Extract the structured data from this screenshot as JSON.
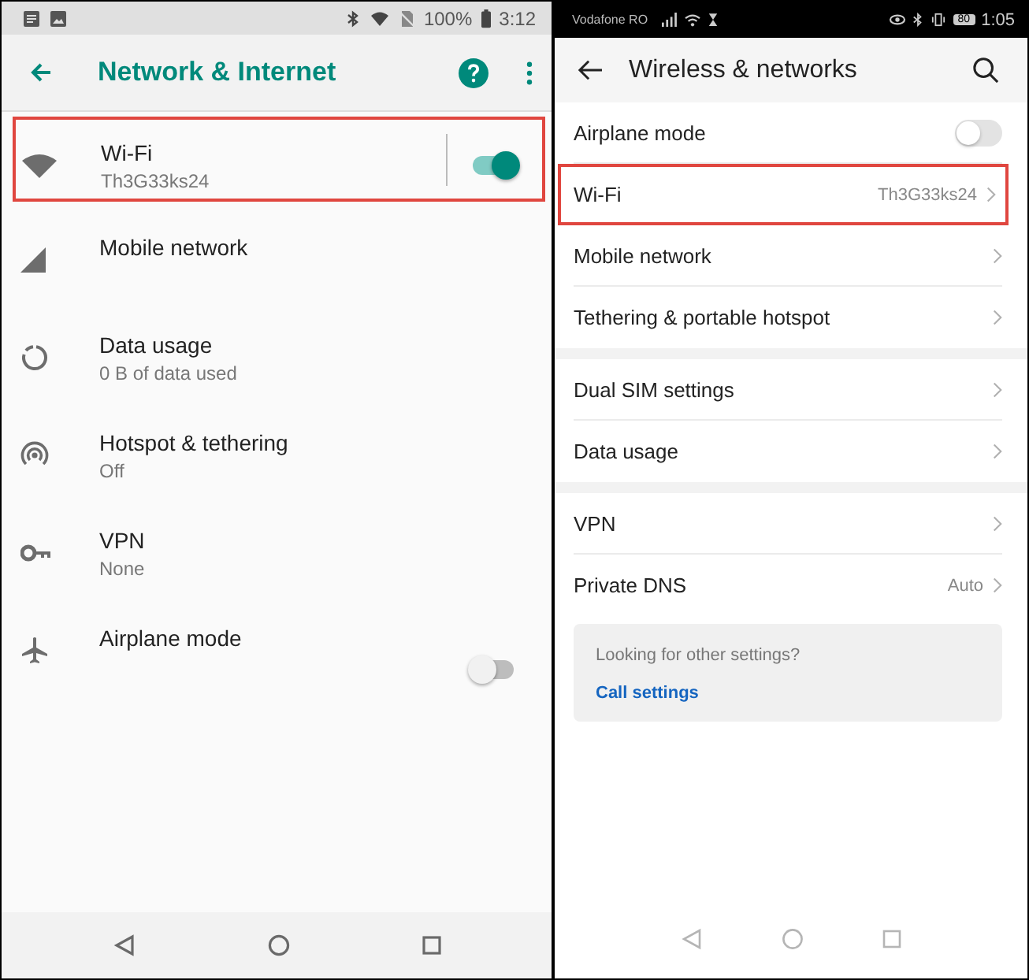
{
  "left_phone": {
    "status_bar": {
      "battery": "100%",
      "time": "3:12"
    },
    "toolbar": {
      "title": "Network & Internet"
    },
    "items": [
      {
        "title": "Wi-Fi",
        "subtitle": "Th3G33ks24",
        "on": true,
        "highlighted": true
      },
      {
        "title": "Mobile network",
        "highlighted": false
      },
      {
        "title": "Data usage",
        "subtitle": "0 B of data used",
        "highlighted": false
      },
      {
        "title": "Hotspot & tethering",
        "subtitle": "Off",
        "highlighted": false
      },
      {
        "title": "VPN",
        "subtitle": "None",
        "highlighted": false
      },
      {
        "title": "Airplane mode",
        "on": false,
        "highlighted": false
      }
    ]
  },
  "right_phone": {
    "status_bar": {
      "carrier": "Vodafone RO",
      "battery": "80",
      "time": "1:05"
    },
    "header": {
      "title": "Wireless & networks"
    },
    "sections": [
      [
        {
          "title": "Airplane mode",
          "on": false,
          "highlighted": false
        },
        {
          "title": "Wi-Fi",
          "value": "Th3G33ks24",
          "highlighted": true
        },
        {
          "title": "Mobile network",
          "highlighted": false
        },
        {
          "title": "Tethering & portable hotspot",
          "highlighted": false
        }
      ],
      [
        {
          "title": "Dual SIM settings",
          "highlighted": false
        },
        {
          "title": "Data usage",
          "highlighted": false
        }
      ],
      [
        {
          "title": "VPN",
          "highlighted": false
        },
        {
          "title": "Private DNS",
          "value": "Auto",
          "highlighted": false
        }
      ]
    ],
    "card": {
      "hint": "Looking for other settings?",
      "link": "Call settings"
    }
  }
}
